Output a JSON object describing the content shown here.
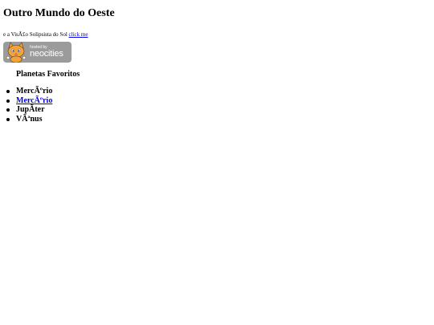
{
  "page": {
    "title": "Outro Mundo do Oeste",
    "subtitle": "e a VisÃ£o Solipsista do Sol",
    "subtitle_link": "click me"
  },
  "badge": {
    "hosted_by": "hosted by",
    "brand": "neocities",
    "mascot_icon": "neocities-cat-icon"
  },
  "favorites": {
    "heading": "Planetas Favoritos",
    "items": [
      {
        "label": "MercÃºrio",
        "link": false
      },
      {
        "label": "MercÃºrio",
        "link": true
      },
      {
        "label": "JupÃter",
        "link": false
      },
      {
        "label": "VÃªnus",
        "link": false
      }
    ]
  },
  "colors": {
    "link": "#0000ee",
    "badge_bg": "#9b9b9b",
    "badge_text": "#ffffff"
  }
}
